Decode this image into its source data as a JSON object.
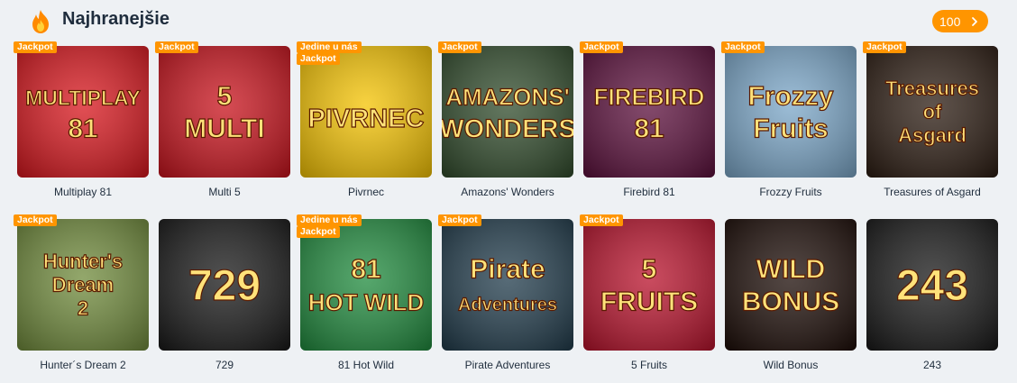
{
  "section": {
    "title": "Najhranejšie",
    "count": "100",
    "fire_icon": "fire-icon",
    "chevron_icon": "chevron-right-icon",
    "accent": "#ff9500"
  },
  "games": [
    {
      "name": "Multiplay 81",
      "badges": [
        "Jackpot"
      ],
      "art": [
        "MULTIPLAY",
        "81"
      ],
      "bg": "#d8141b"
    },
    {
      "name": "Multi 5",
      "badges": [
        "Jackpot"
      ],
      "art": [
        "5",
        "MULTI"
      ],
      "bg": "#c8101a"
    },
    {
      "name": "Pivrnec",
      "badges": [
        "Jedine u nás",
        "Jackpot"
      ],
      "art": [
        "PIVRNEC"
      ],
      "bg": "#f5c300"
    },
    {
      "name": "Amazons' Wonders",
      "badges": [
        "Jackpot"
      ],
      "art": [
        "AMAZONS'",
        "WONDERS"
      ],
      "bg": "#2f4a2a"
    },
    {
      "name": "Firebird 81",
      "badges": [
        "Jackpot"
      ],
      "art": [
        "FIREBIRD",
        "81"
      ],
      "bg": "#5a0d3a"
    },
    {
      "name": "Frozzy Fruits",
      "badges": [
        "Jackpot"
      ],
      "art": [
        "Frozzy",
        "Fruits"
      ],
      "bg": "#7aa6c8"
    },
    {
      "name": "Treasures of Asgard",
      "badges": [
        "Jackpot"
      ],
      "art": [
        "Treasures",
        "of",
        "Asgard"
      ],
      "bg": "#2a1a10"
    },
    {
      "name": "Hunter´s Dream 2",
      "badges": [
        "Jackpot"
      ],
      "art": [
        "Hunter's",
        "Dream",
        "2"
      ],
      "bg": "#6f8a3a"
    },
    {
      "name": "729",
      "badges": [],
      "art": [
        "729"
      ],
      "bg": "#161616"
    },
    {
      "name": "81 Hot Wild",
      "badges": [
        "Jedine u nás",
        "Jackpot"
      ],
      "art": [
        "81",
        "HOT WILD"
      ],
      "bg": "#1e8a3c"
    },
    {
      "name": "Pirate Adventures",
      "badges": [
        "Jackpot"
      ],
      "art": [
        "Pirate",
        "Adventures"
      ],
      "bg": "#1f3a4a"
    },
    {
      "name": "5 Fruits",
      "badges": [
        "Jackpot"
      ],
      "art": [
        "5",
        "FRUITS"
      ],
      "bg": "#b8102a"
    },
    {
      "name": "Wild Bonus",
      "badges": [],
      "art": [
        "WILD",
        "BONUS"
      ],
      "bg": "#1a0a05"
    },
    {
      "name": "243",
      "badges": [],
      "art": [
        "243"
      ],
      "bg": "#161616"
    }
  ]
}
